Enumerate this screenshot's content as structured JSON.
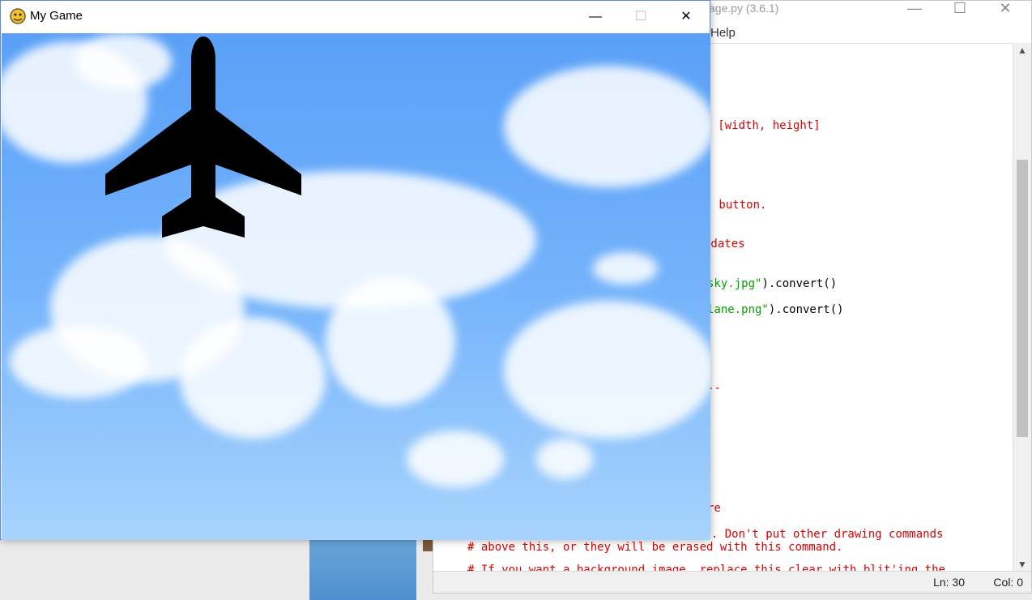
{
  "game_window": {
    "title": "My Game",
    "icon": "pygame-snake-icon",
    "controls": {
      "minimize": "—",
      "maximize": "☐",
      "close": "✕"
    },
    "sprite": "airplane-silhouette",
    "background": "sky-with-clouds"
  },
  "idle_window": {
    "title_fragment": "age.py (3.6.1)",
    "menu_fragment": "Help",
    "controls": {
      "minimize": "—",
      "maximize": "☐",
      "close": "✕"
    },
    "code_lines": {
      "l1": "en [width, height]",
      "l2": " button.",
      "l3": "odates",
      "l4_str": "sky.jpg\"",
      "l4_rest": ").convert()",
      "l5_str": "lane.png\"",
      "l5_rest": ").convert()",
      "l6": "--",
      "l7": "re",
      "l8": "te. Don't put other drawing commands",
      "l9": "# above this, or they will be erased with this command.",
      "l10": "# If you want a background image, replace this clear with blit'ing the"
    },
    "status": {
      "line": "Ln: 30",
      "col": "Col: 0"
    },
    "colors": {
      "comment": "#e00000",
      "string": "#00a000"
    }
  }
}
